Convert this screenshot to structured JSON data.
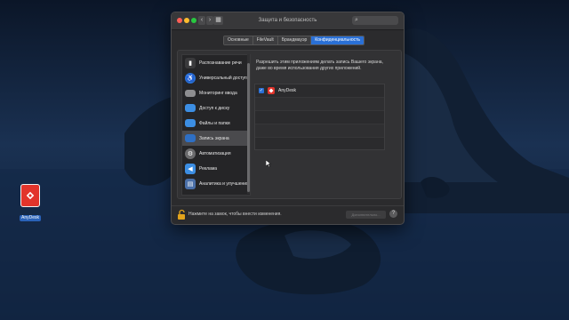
{
  "desktop": {
    "icon_label": "AnyDesk",
    "icon_name": "anydesk-app-icon"
  },
  "window": {
    "title": "Защита и безопасность",
    "search_placeholder": "",
    "tabs": [
      {
        "label": "Основные",
        "active": false
      },
      {
        "label": "FileVault",
        "active": false
      },
      {
        "label": "Брандмауэр",
        "active": false
      },
      {
        "label": "Конфиденциальность",
        "active": true
      }
    ],
    "sidebar": [
      {
        "label": "Распознавание речи",
        "icon": "speech-recognition-icon",
        "color": "#3a3a3c",
        "selected": false
      },
      {
        "label": "Универсальный доступ",
        "icon": "accessibility-icon",
        "color": "#2a70d6",
        "selected": false
      },
      {
        "label": "Мониторинг ввода",
        "icon": "keyboard-icon",
        "color": "#8e8e90",
        "selected": false
      },
      {
        "label": "Доступ к диску",
        "icon": "folder-icon",
        "color": "#3c8ee3",
        "selected": false
      },
      {
        "label": "Файлы и папки",
        "icon": "folder-icon",
        "color": "#3c8ee3",
        "selected": false
      },
      {
        "label": "Запись экрана",
        "icon": "screen-recording-icon",
        "color": "#2e6fc4",
        "selected": true
      },
      {
        "label": "Автоматизация",
        "icon": "gear-icon",
        "color": "#6b6b6d",
        "selected": false
      },
      {
        "label": "Реклама",
        "icon": "megaphone-icon",
        "color": "#3c8ee3",
        "selected": false
      },
      {
        "label": "Аналитика и улучшения",
        "icon": "analytics-icon",
        "color": "#4a6fa8",
        "selected": false
      }
    ],
    "description": "Разрешить этим приложениям делать запись Вашего экрана, даже во время использования других приложений.",
    "apps": [
      {
        "name": "AnyDesk",
        "checked": true
      }
    ],
    "lock_text": "Нажмите на замок, чтобы внести изменения.",
    "advanced_label": "Дополнительно...",
    "help_label": "?"
  },
  "colors": {
    "accent": "#2a70d6",
    "anydesk": "#e2342b"
  }
}
